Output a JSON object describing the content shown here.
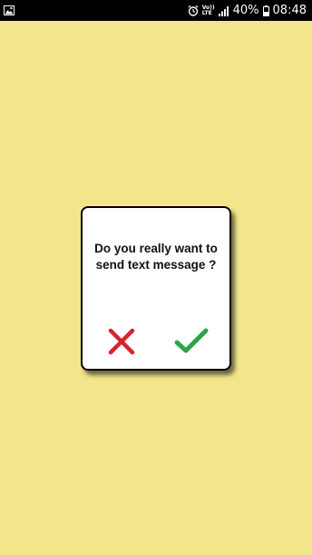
{
  "status_bar": {
    "left_icon": "gallery-notification-icon",
    "alarm_icon": "alarm-icon",
    "volte_line1": "Vo))",
    "volte_line2": "LTE",
    "signal_icon": "signal-icon",
    "battery_percent": "40%",
    "battery_icon": "battery-icon",
    "time": "08:48"
  },
  "dialog": {
    "message_line1": "Do you really want to",
    "message_line2": "send text message ?",
    "cancel_icon": "close-icon",
    "confirm_icon": "check-icon"
  },
  "colors": {
    "background": "#f2e68b",
    "cancel": "#d8232a",
    "confirm": "#2ea34a"
  }
}
